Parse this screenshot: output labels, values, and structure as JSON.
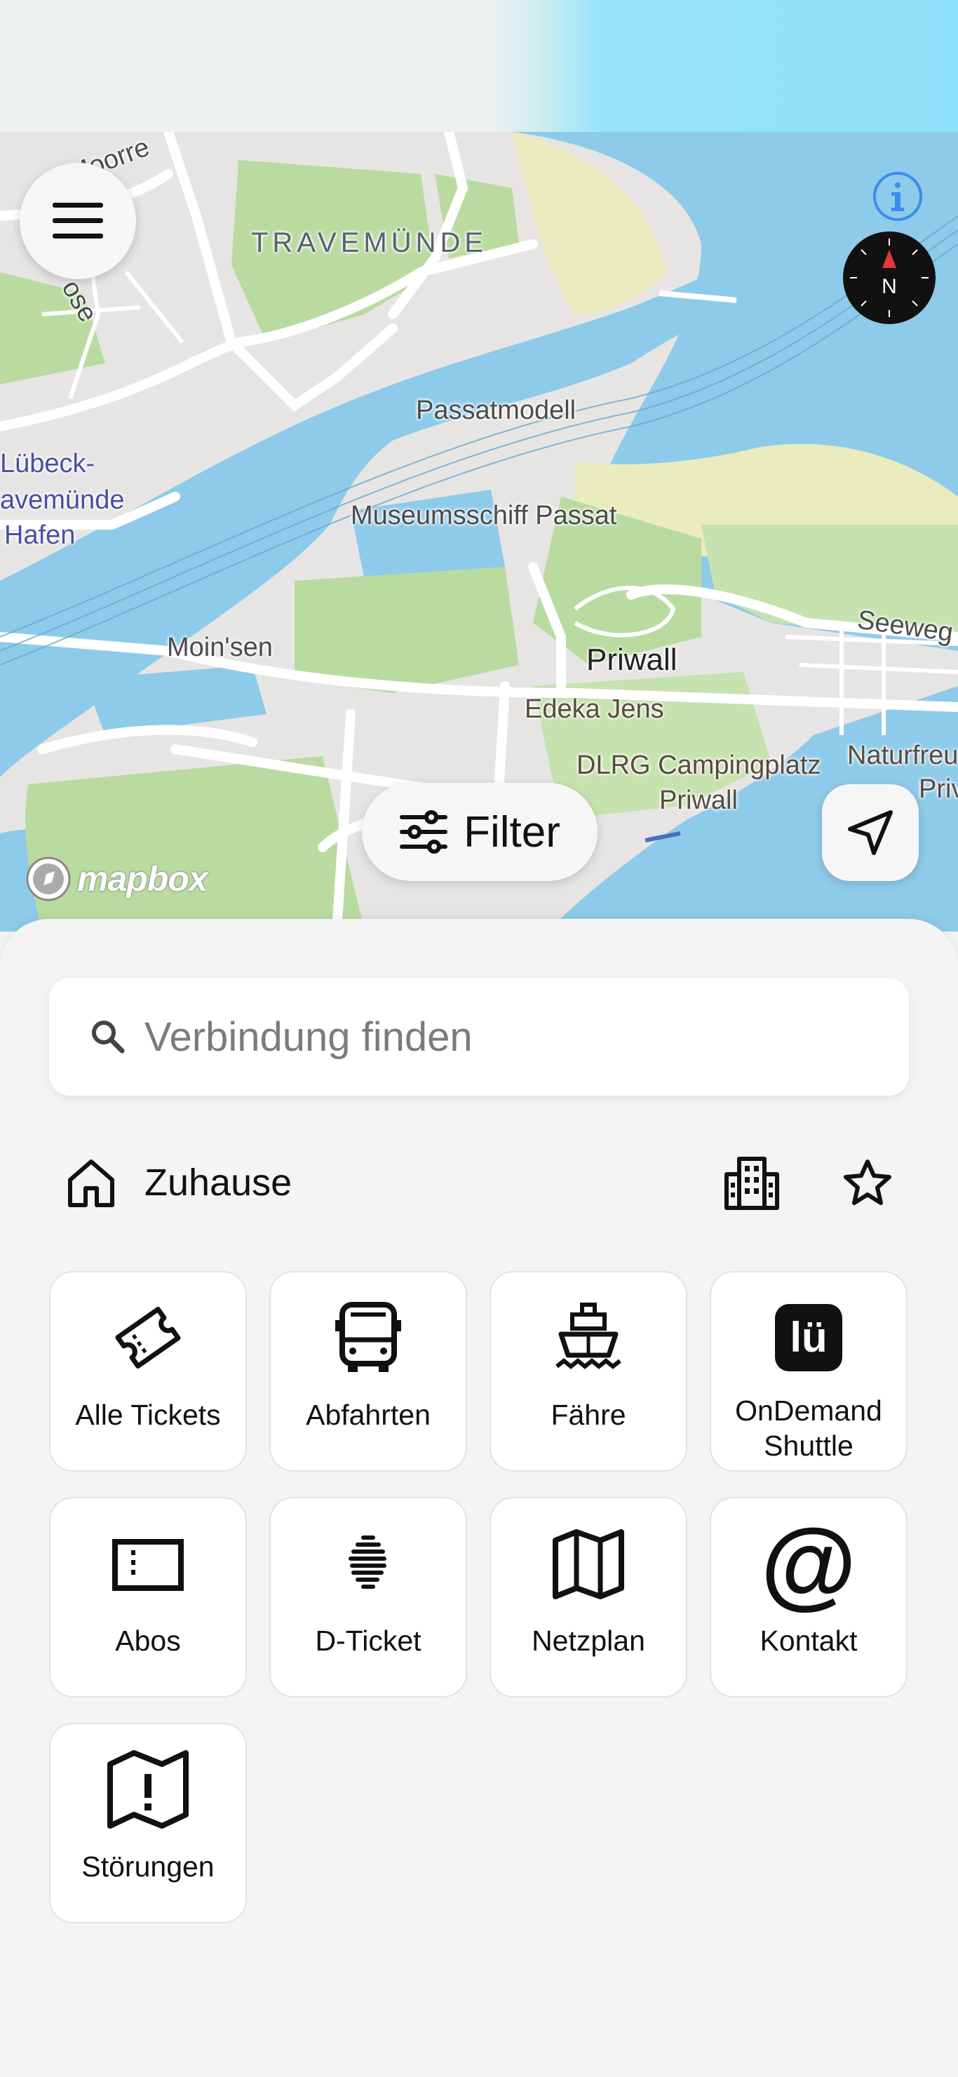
{
  "map": {
    "labels": {
      "moorrege": "Moorre",
      "rose": "ose",
      "town": "TRAVEMÜNDE",
      "passatmodell": "Passatmodell",
      "luebeck_line1": "Lübeck-",
      "luebeck_line2": "avemünde",
      "luebeck_line3": "Hafen",
      "museumsschiff": "Museumsschiff Passat",
      "moinsen": "Moin'sen",
      "priwall": "Priwall",
      "seeweg": "Seeweg",
      "edeka": "Edeka Jens",
      "dlrg_line1": "DLRG Campingplatz",
      "dlrg_line2": "Priwall",
      "naturfreunde_line1": "Naturfreu",
      "naturfreunde_line2": "Priv"
    },
    "attribution": "mapbox",
    "compass_letter": "N",
    "filter_label": "Filter"
  },
  "search": {
    "placeholder": "Verbindung finden"
  },
  "quick": {
    "home_label": "Zuhause"
  },
  "tiles": [
    {
      "label": "Alle Tickets",
      "icon": "ticket-icon"
    },
    {
      "label": "Abfahrten",
      "icon": "bus-icon"
    },
    {
      "label": "Fähre",
      "icon": "ferry-icon"
    },
    {
      "label": "OnDemand Shuttle",
      "icon": "ondemand-icon",
      "icon_text": "lü"
    },
    {
      "label": "Abos",
      "icon": "subscription-ticket-icon"
    },
    {
      "label": "D-Ticket",
      "icon": "d-ticket-icon"
    },
    {
      "label": "Netzplan",
      "icon": "map-icon"
    },
    {
      "label": "Kontakt",
      "icon": "at-icon",
      "icon_text": "@"
    },
    {
      "label": "Störungen",
      "icon": "disruption-map-icon"
    }
  ],
  "colors": {
    "water": "#8ecbea",
    "land": "#e7e5e3",
    "park": "#b9dba0",
    "beach": "#eaebbe",
    "accent_info": "#3a8cf0",
    "compass_red": "#e53935"
  }
}
